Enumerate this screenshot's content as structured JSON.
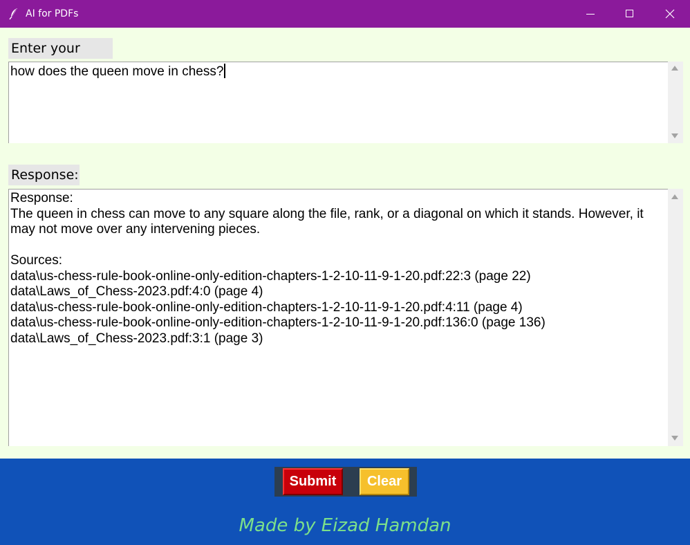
{
  "window": {
    "title": "AI for PDFs",
    "icon": "feather-icon",
    "controls": [
      "minimize-icon",
      "maximize-icon",
      "close-icon"
    ]
  },
  "query": {
    "label": "Enter your query:",
    "value": "how does the queen move in chess?"
  },
  "response": {
    "label": "Response:",
    "text": "Response:\nThe queen in chess can move to any square along the file, rank, or a diagonal on which it stands. However, it may not move over any intervening pieces.\n\nSources:\ndata\\us-chess-rule-book-online-only-edition-chapters-1-2-10-11-9-1-20.pdf:22:3 (page 22)\ndata\\Laws_of_Chess-2023.pdf:4:0 (page 4)\ndata\\us-chess-rule-book-online-only-edition-chapters-1-2-10-11-9-1-20.pdf:4:11 (page 4)\ndata\\us-chess-rule-book-online-only-edition-chapters-1-2-10-11-9-1-20.pdf:136:0 (page 136)\ndata\\Laws_of_Chess-2023.pdf:3:1 (page 3)"
  },
  "buttons": {
    "submit_label": "Submit",
    "clear_label": "Clear"
  },
  "footer": {
    "credit": "Made by Eizad Hamdan"
  },
  "colors": {
    "titlebar": "#8b1a9b",
    "background": "#f3ffe6",
    "footer": "#1052b8",
    "submit": "#c8000a",
    "clear": "#f6c02c",
    "credit": "#7ce08a"
  }
}
